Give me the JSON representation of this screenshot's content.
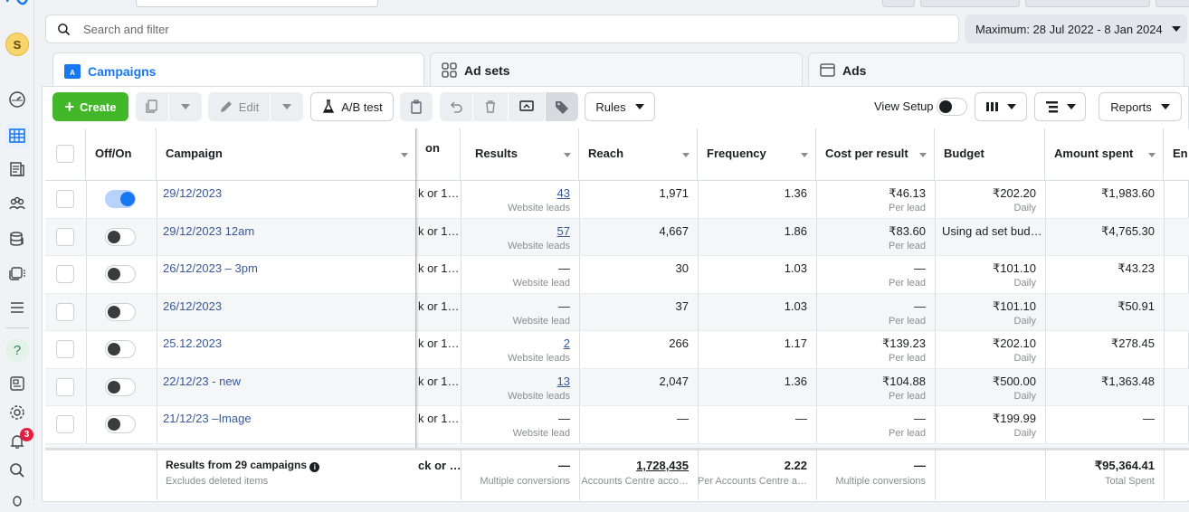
{
  "notification_count": "3",
  "avatar_letter": "S",
  "search": {
    "placeholder": "Search and filter"
  },
  "date_range": "Maximum: 28 Jul 2022 - 8 Jan 2024",
  "tabs": {
    "campaigns": "Campaigns",
    "ad_sets": "Ad sets",
    "ads": "Ads"
  },
  "toolbar": {
    "create": "Create",
    "edit": "Edit",
    "ab_test": "A/B test",
    "rules": "Rules",
    "view_setup": "View Setup",
    "reports": "Reports"
  },
  "columns": {
    "off_on": "Off/On",
    "campaign": "Campaign",
    "partial": "on",
    "results": "Results",
    "reach": "Reach",
    "frequency": "Frequency",
    "cost_per_result": "Cost per result",
    "budget": "Budget",
    "amount_spent": "Amount spent",
    "ends": "En"
  },
  "rows": [
    {
      "on": true,
      "name": "29/12/2023",
      "partial": "k or 1…",
      "results": "43",
      "results_sub": "Website leads",
      "reach": "1,971",
      "frequency": "1.36",
      "cpr": "₹46.13",
      "cpr_sub": "Per lead",
      "budget": "₹202.20",
      "budget_sub": "Daily",
      "spent": "₹1,983.60"
    },
    {
      "on": false,
      "name": "29/12/2023 12am",
      "partial": "k or 1…",
      "results": "57",
      "results_sub": "Website leads",
      "reach": "4,667",
      "frequency": "1.86",
      "cpr": "₹83.60",
      "cpr_sub": "Per lead",
      "budget": "Using ad set bud…",
      "budget_sub": "",
      "spent": "₹4,765.30"
    },
    {
      "on": false,
      "name": "26/12/2023 – 3pm",
      "partial": "k or 1…",
      "results": "—",
      "results_sub": "Website lead",
      "reach": "30",
      "frequency": "1.03",
      "cpr": "—",
      "cpr_sub": "Per lead",
      "budget": "₹101.10",
      "budget_sub": "Daily",
      "spent": "₹43.23"
    },
    {
      "on": false,
      "name": "26/12/2023",
      "partial": "k or 1…",
      "results": "—",
      "results_sub": "Website lead",
      "reach": "37",
      "frequency": "1.03",
      "cpr": "—",
      "cpr_sub": "Per lead",
      "budget": "₹101.10",
      "budget_sub": "Daily",
      "spent": "₹50.91"
    },
    {
      "on": false,
      "name": "25.12.2023",
      "partial": "k or 1…",
      "results": "2",
      "results_sub": "Website leads",
      "reach": "266",
      "frequency": "1.17",
      "cpr": "₹139.23",
      "cpr_sub": "Per lead",
      "budget": "₹202.10",
      "budget_sub": "Daily",
      "spent": "₹278.45"
    },
    {
      "on": false,
      "name": "22/12/23 - new",
      "partial": "k or 1…",
      "results": "13",
      "results_sub": "Website leads",
      "reach": "2,047",
      "frequency": "1.36",
      "cpr": "₹104.88",
      "cpr_sub": "Per lead",
      "budget": "₹500.00",
      "budget_sub": "Daily",
      "spent": "₹1,363.48"
    },
    {
      "on": false,
      "name": "21/12/23 –Image",
      "partial": "k or 1…",
      "results": "—",
      "results_sub": "Website lead",
      "reach": "—",
      "frequency": "—",
      "cpr": "—",
      "cpr_sub": "Per lead",
      "budget": "₹199.99",
      "budget_sub": "Daily",
      "spent": "—"
    }
  ],
  "footer": {
    "title": "Results from 29 campaigns",
    "subtitle": "Excludes deleted items",
    "partial": "ck or …",
    "results": "—",
    "results_sub": "Multiple conversions",
    "reach": "1,728,435",
    "reach_sub": "Accounts Centre acco…",
    "frequency": "2.22",
    "frequency_sub": "Per Accounts Centre a…",
    "cpr": "—",
    "cpr_sub": "Multiple conversions",
    "spent": "₹95,364.41",
    "spent_sub": "Total Spent"
  },
  "colors": {
    "accent": "#1877f2",
    "create": "#42b72a",
    "link": "#385898",
    "badge": "#e41e3f"
  }
}
